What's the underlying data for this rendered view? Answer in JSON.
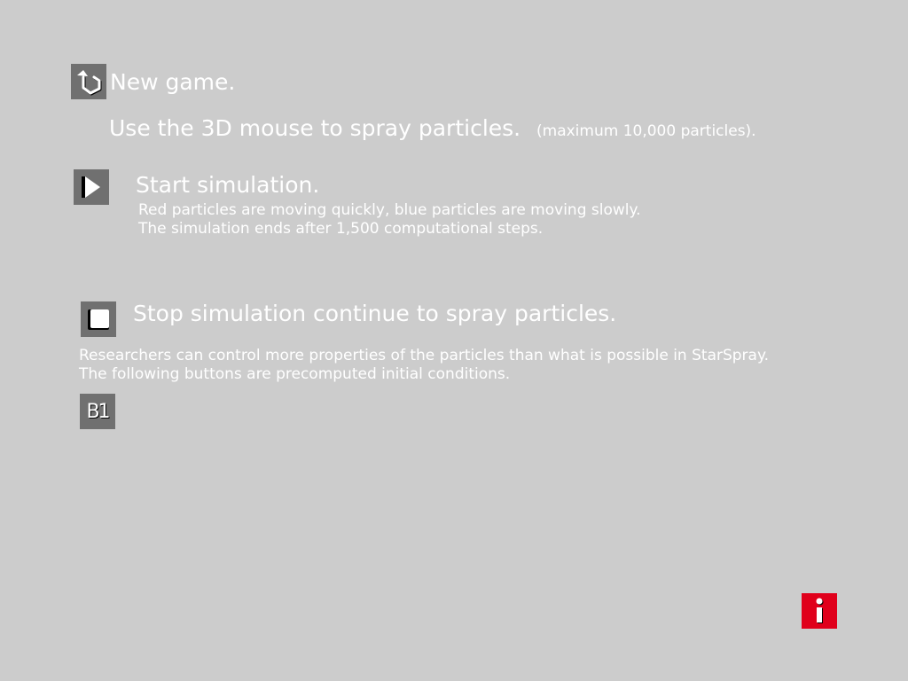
{
  "controls": {
    "new_game": {
      "icon": "restart-icon",
      "label": "New game."
    },
    "instruction": {
      "main": "Use the 3D mouse to spray particles.",
      "note": "(maximum 10,000 particles)."
    },
    "start": {
      "icon": "play-icon",
      "label": "Start simulation.",
      "desc_line1": "Red particles are moving quickly, blue particles are moving slowly.",
      "desc_line2": "The simulation ends after 1,500 computational steps."
    },
    "stop": {
      "icon": "stop-icon",
      "label": "Stop simulation continue to spray particles."
    },
    "research": {
      "line1": "Researchers can control more properties of the particles than what is possible in StarSpray.",
      "line2": "The following buttons are precomputed initial conditions."
    },
    "preset_b1": {
      "label": "B1"
    },
    "info": {
      "icon": "info-icon"
    }
  },
  "colors": {
    "background": "#cccccc",
    "button": "#707070",
    "info": "#e0001b",
    "text": "#ffffff"
  }
}
